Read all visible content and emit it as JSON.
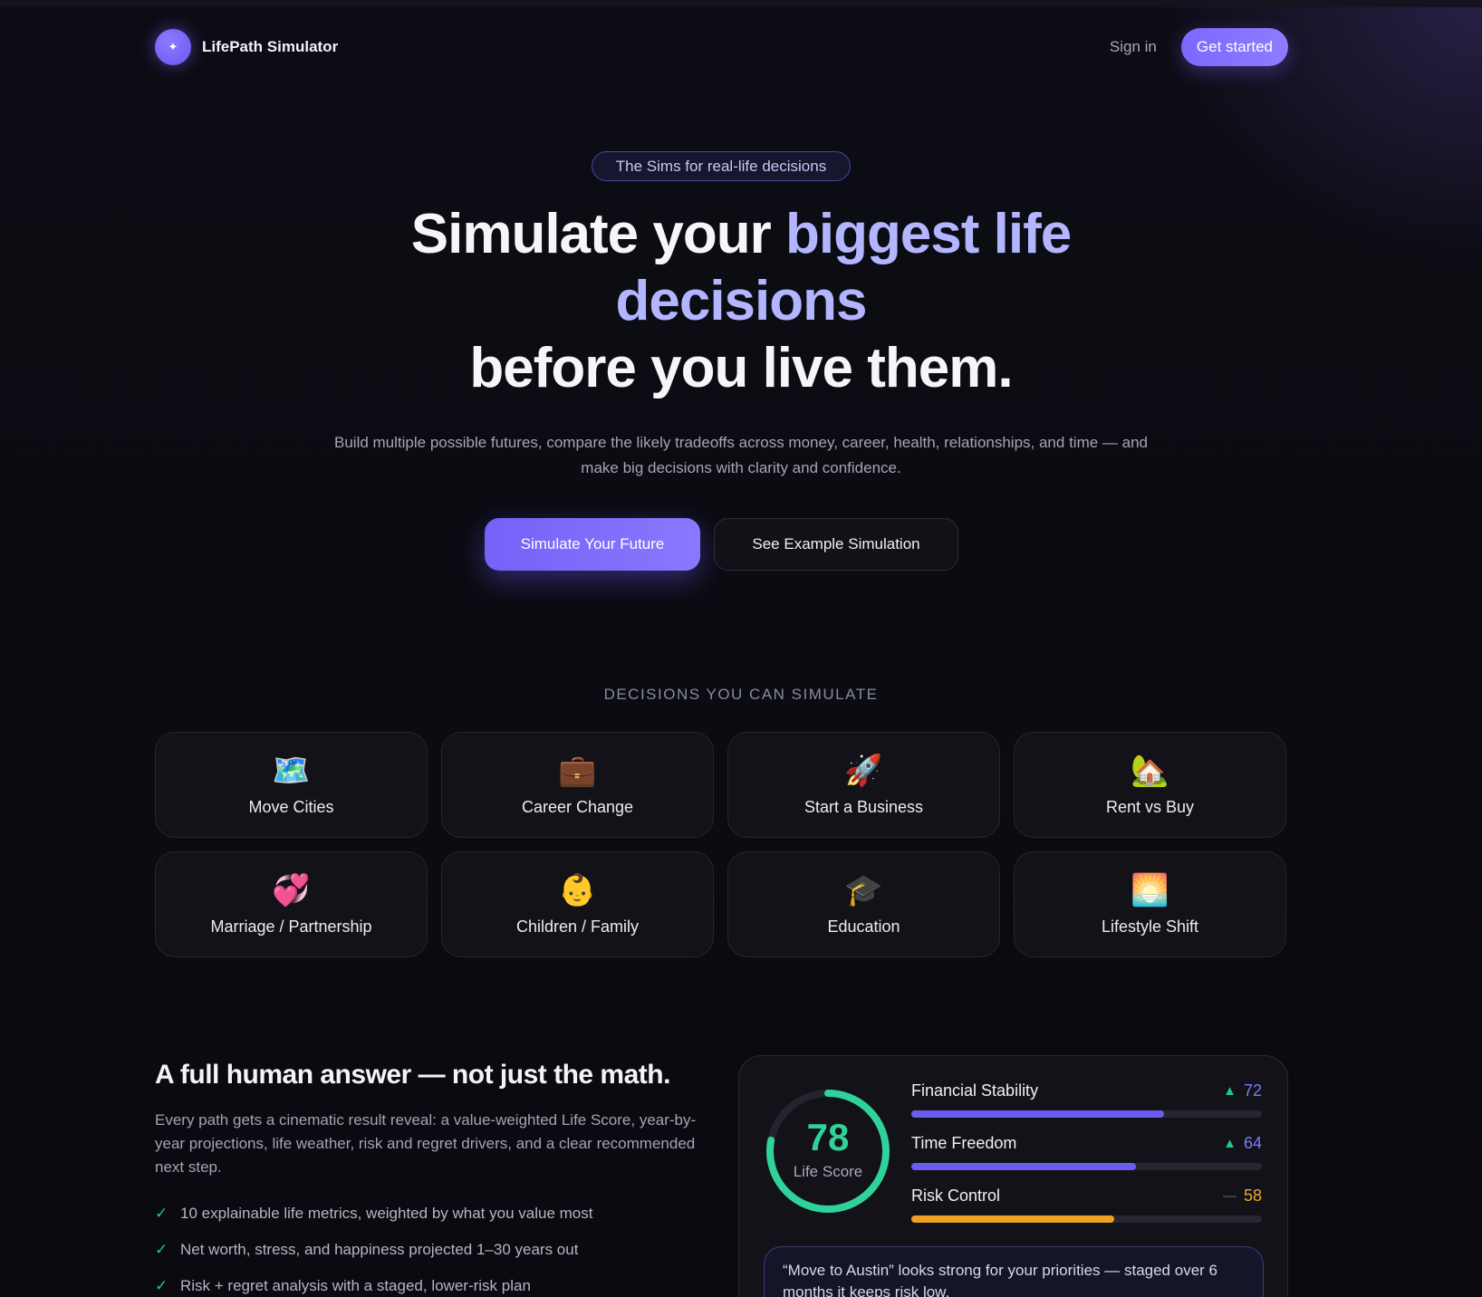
{
  "nav": {
    "logo_glyph": "✦",
    "brand": "LifePath Simulator",
    "signin": "Sign in",
    "cta": "Get started"
  },
  "hero": {
    "pill": "The Sims for real-life decisions",
    "headline_part1": "Simulate your ",
    "headline_accent": "biggest life decisions",
    "headline_part2": "before you live them.",
    "subtitle": "Build multiple possible futures, compare the likely tradeoffs across money, career, health, relationships, and time — and make big decisions with clarity and confidence.",
    "primary_button": "Simulate Your Future",
    "secondary_button": "See Example Simulation"
  },
  "decisions": {
    "label": "DECISIONS YOU CAN SIMULATE",
    "items": [
      {
        "icon": "🗺️",
        "icon_name": "map-icon",
        "label": "Move Cities"
      },
      {
        "icon": "💼",
        "icon_name": "briefcase-icon",
        "label": "Career Change"
      },
      {
        "icon": "🚀",
        "icon_name": "rocket-icon",
        "label": "Start a Business"
      },
      {
        "icon": "🏡",
        "icon_name": "house-icon",
        "label": "Rent vs Buy"
      },
      {
        "icon": "💞",
        "icon_name": "hearts-icon",
        "label": "Marriage / Partnership"
      },
      {
        "icon": "👶",
        "icon_name": "baby-icon",
        "label": "Children / Family"
      },
      {
        "icon": "🎓",
        "icon_name": "graduation-cap-icon",
        "label": "Education"
      },
      {
        "icon": "🌅",
        "icon_name": "sunrise-icon",
        "label": "Lifestyle Shift"
      }
    ]
  },
  "lower": {
    "title": "A full human answer — not just the math.",
    "description": "Every path gets a cinematic result reveal: a value-weighted Life Score, year-by-year projections, life weather, risk and regret drivers, and a clear recommended next step.",
    "checklist": [
      "10 explainable life metrics, weighted by what you value most",
      "Net worth, stress, and happiness projected 1–30 years out",
      "Risk + regret analysis with a staged, lower-risk plan"
    ]
  },
  "score_panel": {
    "score": "78",
    "score_fraction": 0.78,
    "score_label": "Life Score",
    "metrics": [
      {
        "name": "Financial Stability",
        "trend": "▲",
        "value": "72",
        "fill": 0.72,
        "color": "#6a5df0",
        "value_color": "#7c7cff",
        "trend_color": "#22c58a"
      },
      {
        "name": "Time Freedom",
        "trend": "▲",
        "value": "64",
        "fill": 0.64,
        "color": "#6a5df0",
        "value_color": "#7c7cff",
        "trend_color": "#22c58a"
      },
      {
        "name": "Risk Control",
        "trend": "—",
        "value": "58",
        "fill": 0.58,
        "color": "#f0a020",
        "value_color": "#f5a623",
        "trend_color": "#6a6a7a"
      }
    ],
    "quote": "“Move to Austin” looks strong for your priorities — staged over 6 months it keeps risk low."
  },
  "colors": {
    "accent": "#7d68ff",
    "score_green": "#2fd39a",
    "background": "#0b0b12"
  }
}
